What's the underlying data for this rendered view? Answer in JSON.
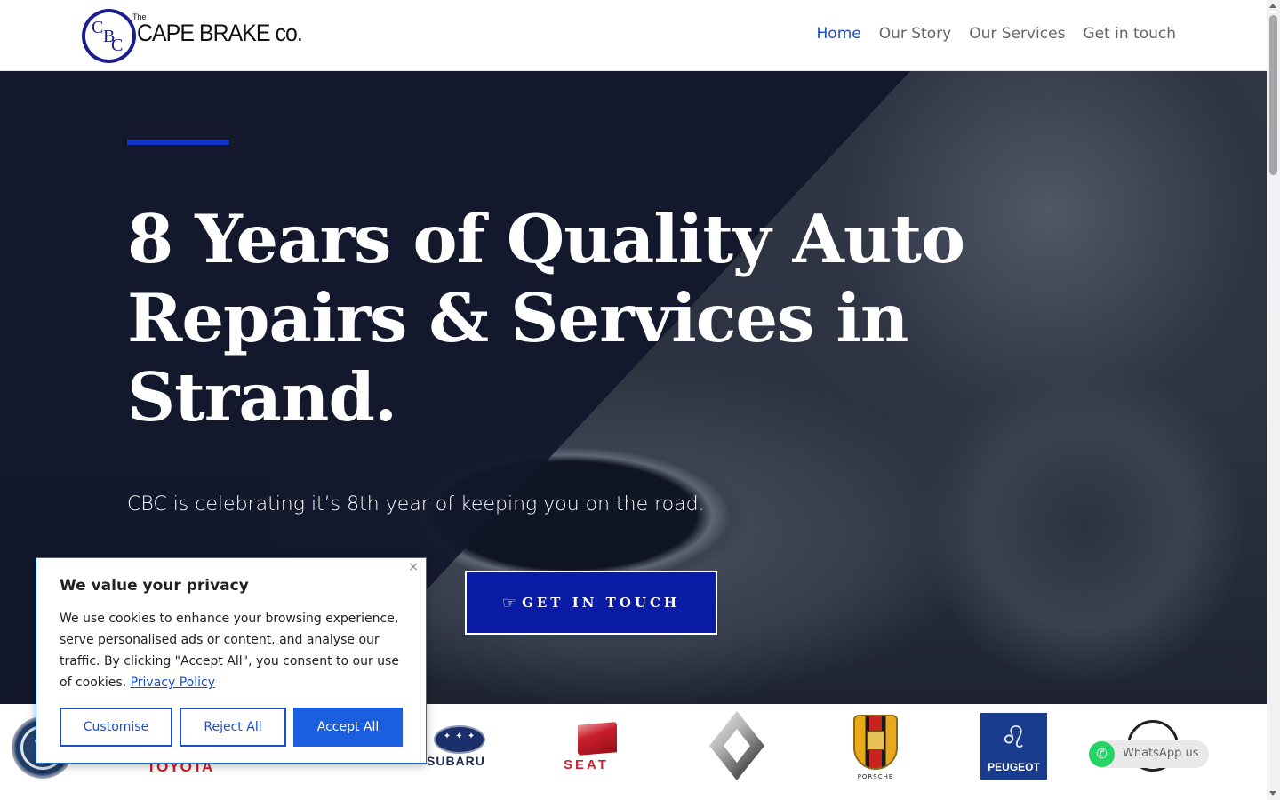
{
  "header": {
    "logo": {
      "monogram": [
        "C",
        "B",
        "C"
      ],
      "the": "The",
      "name": "CAPE BRAKE co."
    },
    "nav": [
      {
        "label": "Home",
        "active": true
      },
      {
        "label": "Our Story",
        "active": false
      },
      {
        "label": "Our Services",
        "active": false
      },
      {
        "label": "Get in touch",
        "active": false
      }
    ]
  },
  "hero": {
    "title": "8 Years of Quality Auto Repairs & Services in Strand.",
    "subtitle": "CBC is celebrating it’s 8th year of keeping you on the road.",
    "cta_label": "GET IN TOUCH",
    "cta_icon": "pointing-hand-icon"
  },
  "brands": {
    "items": [
      {
        "name": "Volkswagen",
        "icon": "vw-logo"
      },
      {
        "name": "TOYOTA",
        "icon": "toyota-logo"
      },
      {
        "name": "SUBARU",
        "icon": "subaru-logo"
      },
      {
        "name": "SEAT",
        "icon": "seat-logo"
      },
      {
        "name": "Renault",
        "icon": "renault-logo"
      },
      {
        "name": "PORSCHE",
        "icon": "porsche-logo"
      },
      {
        "name": "PEUGEOT",
        "icon": "peugeot-logo"
      }
    ]
  },
  "whatsapp": {
    "label": "WhatsApp us",
    "icon": "whatsapp-icon"
  },
  "cookie": {
    "title": "We value your privacy",
    "body": "We use cookies to enhance your browsing experience, serve personalised ads or content, and analyse our traffic. By clicking \"Accept All\", you consent to our use of cookies.",
    "link": "Privacy Policy",
    "close": "×",
    "buttons": {
      "customise": "Customise",
      "reject": "Reject All",
      "accept": "Accept All"
    }
  },
  "colors": {
    "brand_blue": "#0a1ca6",
    "nav_active": "#1b4fc4",
    "accent_bar": "#1433c9",
    "cookie_accept": "#1b5fe0",
    "whatsapp_green": "#25d366"
  }
}
